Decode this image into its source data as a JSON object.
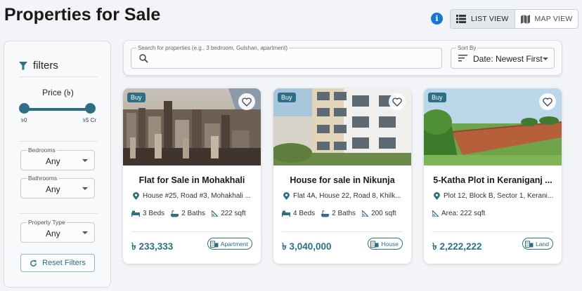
{
  "page": {
    "title": "Properties for Sale"
  },
  "header": {
    "info_icon": "info-icon",
    "view_toggle": {
      "list_label": "LIST VIEW",
      "map_label": "MAP VIEW",
      "active": "list"
    }
  },
  "filters": {
    "title": "filters",
    "price": {
      "label": "Price (৳)",
      "min_label": "৳0",
      "max_label": "৳5 Cr"
    },
    "bedrooms": {
      "label": "Bedrooms",
      "value": "Any"
    },
    "bathrooms": {
      "label": "Bathrooms",
      "value": "Any"
    },
    "property_type": {
      "label": "Property Type",
      "value": "Any"
    },
    "reset_label": "Reset Filters"
  },
  "search": {
    "label": "Search for properties (e.g., 3 bedroom, Gulshan, apartment)",
    "value": "",
    "sort_label": "Sort By",
    "sort_value": "Date: Newest First"
  },
  "listings": [
    {
      "badge": "Buy",
      "title": "Flat for Sale in Mohakhali",
      "address": "House #25, Road #3, Mohakhali ...",
      "beds": "3 Beds",
      "baths": "2 Baths",
      "area": "222 sqft",
      "price": "৳ 233,333",
      "type": "Apartment",
      "image": "city-aerial"
    },
    {
      "badge": "Buy",
      "title": "House for sale in Nikunja",
      "address": "Flat 4A, House 22, Road 8, Khilk...",
      "beds": "4 Beds",
      "baths": "2 Baths",
      "area": "200 sqft",
      "price": "৳ 3,040,000",
      "type": "House",
      "image": "apartment-building"
    },
    {
      "badge": "Buy",
      "title": "5-Katha Plot in Keraniganj ...",
      "address": "Plot 12, Block B, Sector 1, Kerani...",
      "area": "Area: 222 sqft",
      "price": "৳ 2,222,222",
      "type": "Land",
      "image": "land-plot"
    }
  ],
  "colors": {
    "accent": "#2e6f86",
    "info": "#1976d2",
    "background": "#f2f4f7"
  }
}
